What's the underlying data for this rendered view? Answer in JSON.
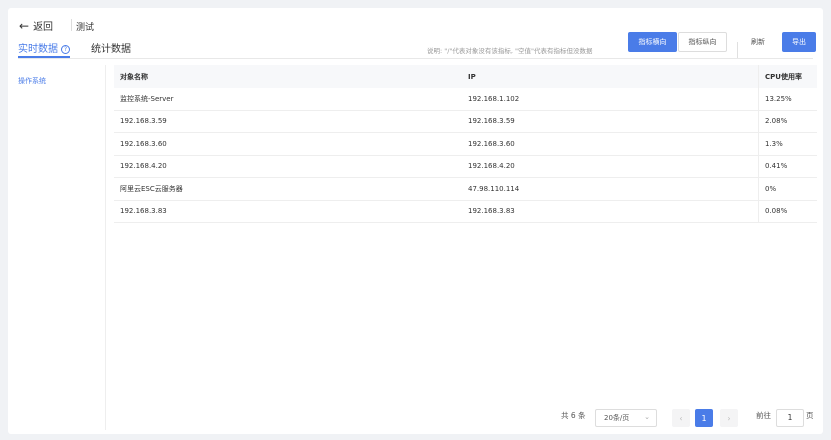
{
  "header": {
    "back_label": "返回",
    "title": "测试"
  },
  "tabs": [
    {
      "label": "实时数据",
      "active": true
    },
    {
      "label": "统计数据",
      "active": false
    }
  ],
  "note": "说明: \"/\"代表对象没有该指标, \"空值\"代表有指标但没数据",
  "toolbar": {
    "horizontal_label": "指标横向",
    "vertical_label": "指标纵向",
    "refresh_label": "刷新",
    "export_label": "导出"
  },
  "sidebar": {
    "items": [
      {
        "label": "操作系统"
      }
    ]
  },
  "table": {
    "columns": [
      "对象名称",
      "IP",
      "CPU使用率"
    ],
    "rows": [
      [
        "监控系统-Server",
        "192.168.1.102",
        "13.25%"
      ],
      [
        "192.168.3.59",
        "192.168.3.59",
        "2.08%"
      ],
      [
        "192.168.3.60",
        "192.168.3.60",
        "1.3%"
      ],
      [
        "192.168.4.20",
        "192.168.4.20",
        "0.41%"
      ],
      [
        "阿里云ESC云服务器",
        "47.98.110.114",
        "0%"
      ],
      [
        "192.168.3.83",
        "192.168.3.83",
        "0.08%"
      ]
    ]
  },
  "pagination": {
    "total_label": "共 6 条",
    "page_size": "20条/页",
    "current_page": "1",
    "goto_prefix": "前往",
    "goto_value": "1",
    "goto_suffix": "页",
    "prev_icon": "‹",
    "next_icon": "›",
    "chevron_icon": "⌄"
  },
  "colors": {
    "accent": "#4a7ce8",
    "background": "#f0f2f5"
  }
}
